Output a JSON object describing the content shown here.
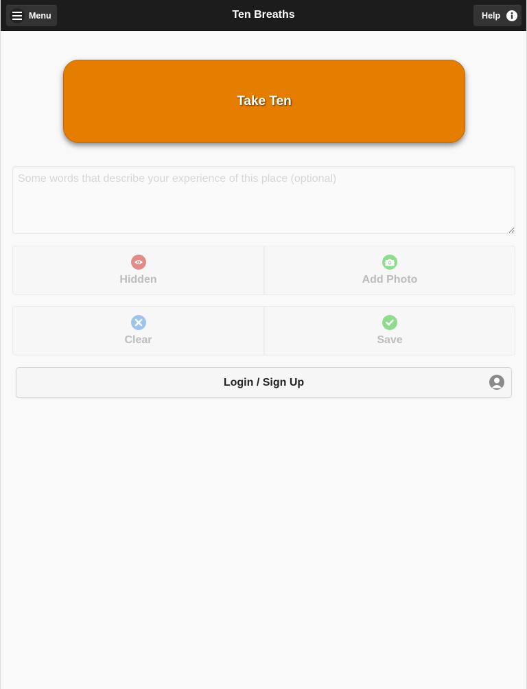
{
  "header": {
    "title": "Ten Breaths",
    "menu_label": "Menu",
    "help_label": "Help"
  },
  "take_ten": {
    "label": "Take Ten"
  },
  "description": {
    "placeholder": "Some words that describe your experience of this place (optional)",
    "value": ""
  },
  "actions": {
    "hidden": {
      "label": "Hidden",
      "icon": "eye-icon",
      "color": "#e38b8b"
    },
    "add_photo": {
      "label": "Add Photo",
      "icon": "camera-icon",
      "color": "#8fdc8f"
    },
    "clear": {
      "label": "Clear",
      "icon": "close-icon",
      "color": "#9ec4ee"
    },
    "save": {
      "label": "Save",
      "icon": "check-icon",
      "color": "#8fdc8f"
    }
  },
  "login": {
    "label": "Login / Sign Up",
    "icon": "user-icon"
  },
  "colors": {
    "accent": "#e57e00",
    "header_bg": "#1c1c1c"
  }
}
